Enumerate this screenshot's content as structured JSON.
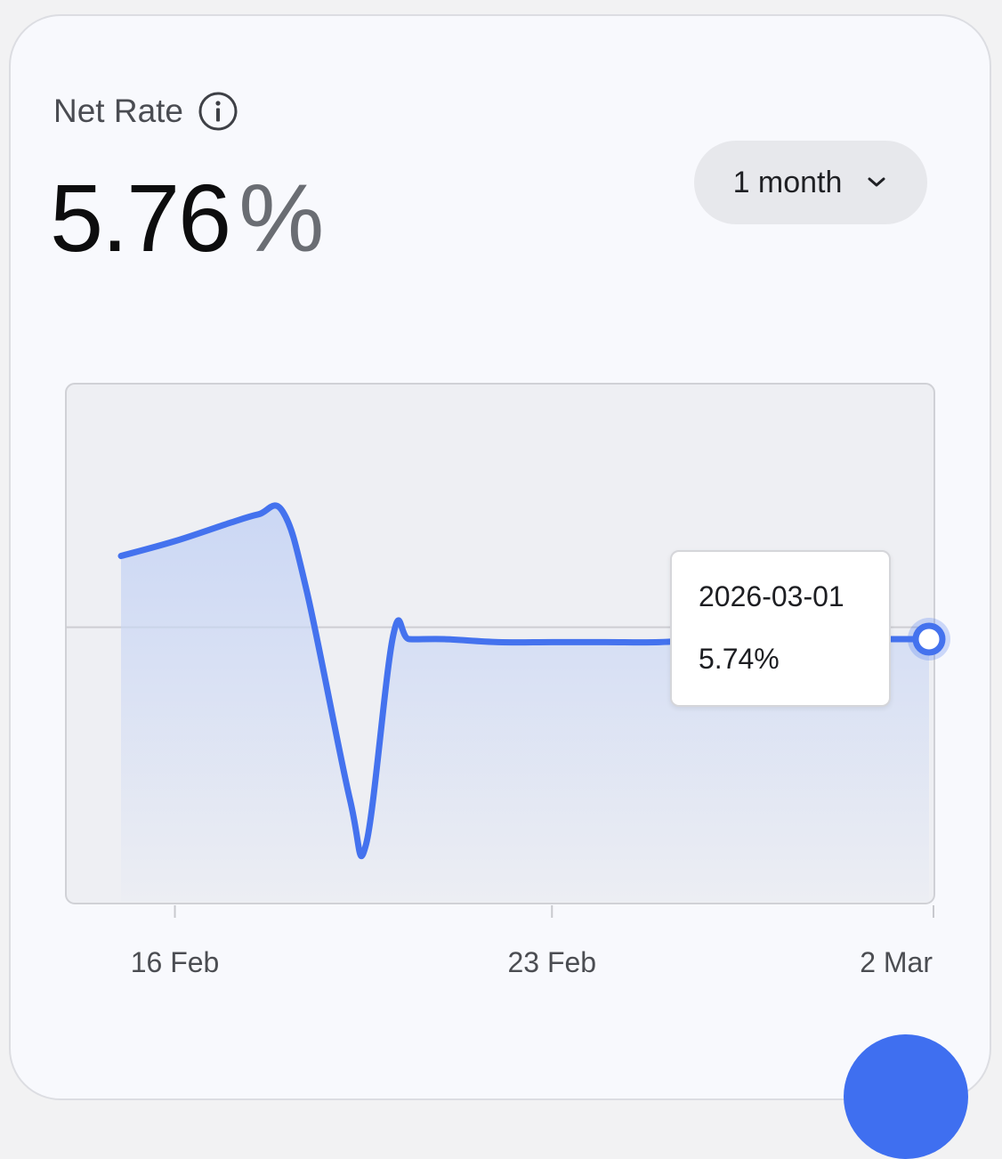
{
  "card": {
    "title": "Net Rate",
    "info_icon": "info-circle-icon",
    "value": "5.76",
    "unit": "%",
    "period_label": "1 month",
    "period_icon": "chevron-down-icon"
  },
  "tooltip": {
    "date": "2026-03-01",
    "value": "5.74%"
  },
  "colors": {
    "line": "#4472ee",
    "fill_top": "#c9d6f4",
    "plot_bg": "#eeeff3",
    "fab": "#3f6ff0"
  },
  "chart_data": {
    "type": "area",
    "x": [
      "2026-02-15",
      "2026-02-16",
      "2026-02-17",
      "2026-02-17",
      "2026-02-18",
      "2026-02-18",
      "2026-02-19",
      "2026-02-19",
      "2026-02-20",
      "2026-02-20",
      "2026-02-21",
      "2026-02-22",
      "2026-02-23",
      "2026-02-24",
      "2026-02-25",
      "2026-02-26",
      "2026-02-27",
      "2026-02-28",
      "2026-03-01",
      "2026-03-02"
    ],
    "x_ticks": [
      "16 Feb",
      "23 Feb",
      "2 Mar"
    ],
    "values": [
      6.02,
      6.07,
      6.13,
      6.16,
      6.17,
      5.9,
      5.2,
      5.05,
      5.75,
      5.74,
      5.74,
      5.73,
      5.73,
      5.73,
      5.73,
      5.74,
      5.74,
      5.74,
      5.74,
      5.74
    ],
    "ylim": [
      4.85,
      6.6
    ],
    "reference_line": 5.78,
    "highlighted_point": {
      "x": "2026-03-02",
      "y": 5.74
    },
    "grid": false
  }
}
